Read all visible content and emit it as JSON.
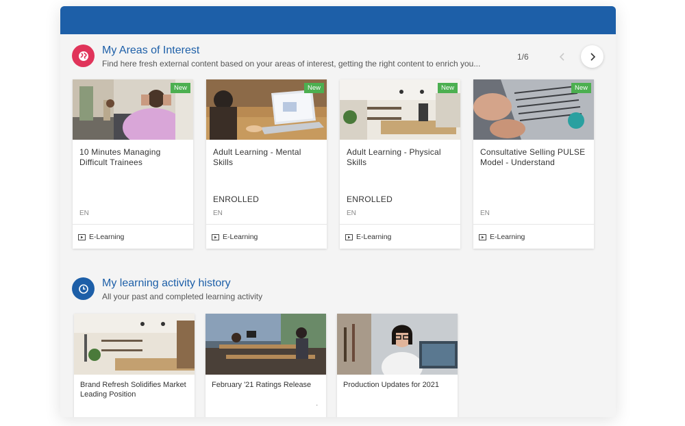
{
  "areas_of_interest": {
    "title": "My Areas of Interest",
    "subtitle": "Find here fresh external content based on your areas of interest, getting the right content to enrich you...",
    "pager": "1/6",
    "icon": "globe-icon",
    "icon_color": "#e0345a",
    "cards": [
      {
        "badge": "New",
        "title": "10 Minutes Managing Difficult Trainees",
        "status": "",
        "lang": "EN",
        "type": "E-Learning"
      },
      {
        "badge": "New",
        "title": "Adult Learning - Mental Skills",
        "status": "ENROLLED",
        "lang": "EN",
        "type": "E-Learning"
      },
      {
        "badge": "New",
        "title": "Adult Learning - Physical Skills",
        "status": "ENROLLED",
        "lang": "EN",
        "type": "E-Learning"
      },
      {
        "badge": "New",
        "title": "Consultative Selling PULSE Model - Understand",
        "status": "",
        "lang": "EN",
        "type": "E-Learning"
      }
    ]
  },
  "learning_history": {
    "title": "My learning activity history",
    "subtitle": "All your past and completed learning activity",
    "icon": "clock-icon",
    "icon_color": "#1d5fa8",
    "cards": [
      {
        "title": "Brand Refresh Solidifies Market Leading Position"
      },
      {
        "title": "February '21 Ratings Release",
        "mark": "."
      },
      {
        "title": "Production Updates for 2021"
      }
    ]
  },
  "colors": {
    "header_bar": "#1d5fa8",
    "badge_new": "#4caf50",
    "title_blue": "#1d5fa8"
  }
}
